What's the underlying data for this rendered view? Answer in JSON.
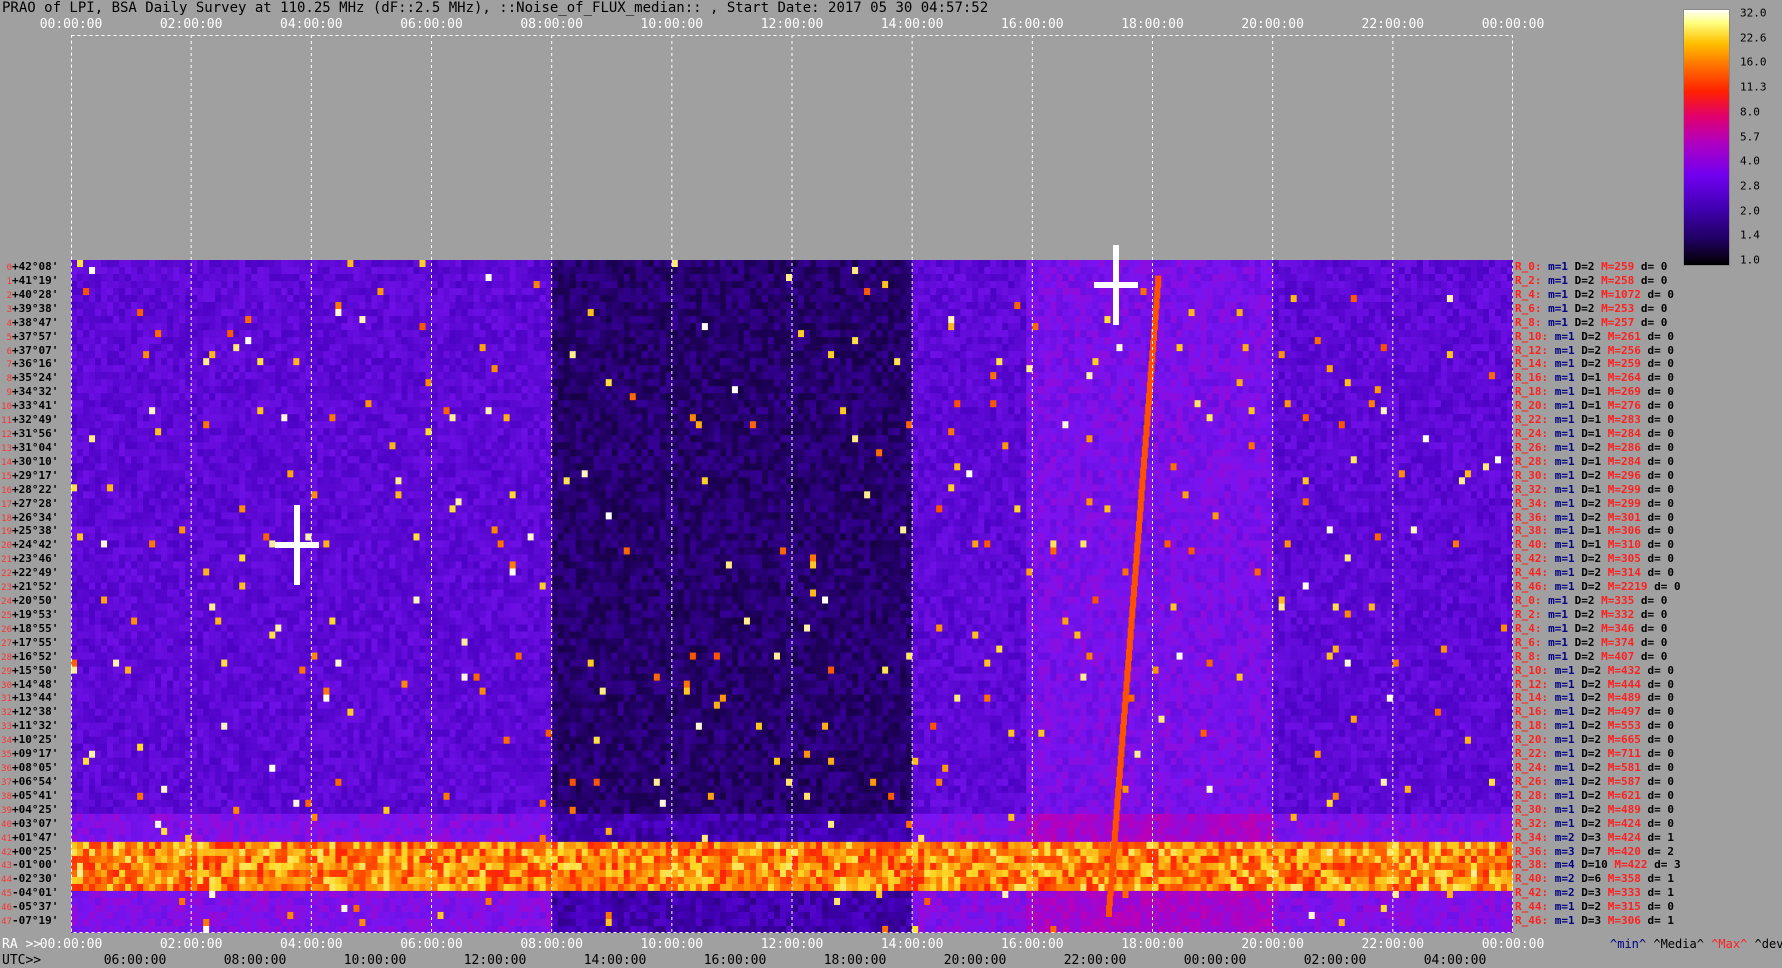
{
  "title": "PRAO of LPI, BSA Daily Survey at 110.25 MHz (dF::2.5 MHz), ::Noise_of_FLUX_median:: , Start Date: 2017 05 30 04:57:52",
  "top_ticks": [
    "00:00:00",
    "02:00:00",
    "04:00:00",
    "06:00:00",
    "08:00:00",
    "10:00:00",
    "12:00:00",
    "14:00:00",
    "16:00:00",
    "18:00:00",
    "20:00:00",
    "22:00:00",
    "00:00:00"
  ],
  "bottom_ra_prefix": "RA >>",
  "bottom_ra_ticks": [
    "00:00:00",
    "02:00:00",
    "04:00:00",
    "06:00:00",
    "08:00:00",
    "10:00:00",
    "12:00:00",
    "14:00:00",
    "16:00:00",
    "18:00:00",
    "20:00:00",
    "22:00:00",
    "00:00:00"
  ],
  "bottom_utc_prefix": "UTC>>",
  "bottom_utc_ticks": [
    "06:00:00",
    "08:00:00",
    "10:00:00",
    "12:00:00",
    "14:00:00",
    "16:00:00",
    "18:00:00",
    "20:00:00",
    "22:00:00",
    "00:00:00",
    "02:00:00",
    "04:00:00"
  ],
  "declinations": [
    {
      "i": "0",
      "d": "+42°08'"
    },
    {
      "i": "1",
      "d": "+41°19'"
    },
    {
      "i": "2",
      "d": "+40°28'"
    },
    {
      "i": "3",
      "d": "+39°38'"
    },
    {
      "i": "4",
      "d": "+38°47'"
    },
    {
      "i": "5",
      "d": "+37°57'"
    },
    {
      "i": "6",
      "d": "+37°07'"
    },
    {
      "i": "7",
      "d": "+36°16'"
    },
    {
      "i": "8",
      "d": "+35°24'"
    },
    {
      "i": "9",
      "d": "+34°32'"
    },
    {
      "i": "10",
      "d": "+33°41'"
    },
    {
      "i": "11",
      "d": "+32°49'"
    },
    {
      "i": "12",
      "d": "+31°56'"
    },
    {
      "i": "13",
      "d": "+31°04'"
    },
    {
      "i": "14",
      "d": "+30°10'"
    },
    {
      "i": "15",
      "d": "+29°17'"
    },
    {
      "i": "16",
      "d": "+28°22'"
    },
    {
      "i": "17",
      "d": "+27°28'"
    },
    {
      "i": "18",
      "d": "+26°34'"
    },
    {
      "i": "19",
      "d": "+25°38'"
    },
    {
      "i": "20",
      "d": "+24°42'"
    },
    {
      "i": "21",
      "d": "+23°46'"
    },
    {
      "i": "22",
      "d": "+22°49'"
    },
    {
      "i": "23",
      "d": "+21°52'"
    },
    {
      "i": "24",
      "d": "+20°50'"
    },
    {
      "i": "25",
      "d": "+19°53'"
    },
    {
      "i": "26",
      "d": "+18°55'"
    },
    {
      "i": "27",
      "d": "+17°55'"
    },
    {
      "i": "28",
      "d": "+16°52'"
    },
    {
      "i": "29",
      "d": "+15°50'"
    },
    {
      "i": "30",
      "d": "+14°48'"
    },
    {
      "i": "31",
      "d": "+13°44'"
    },
    {
      "i": "32",
      "d": "+12°38'"
    },
    {
      "i": "33",
      "d": "+11°32'"
    },
    {
      "i": "34",
      "d": "+10°25'"
    },
    {
      "i": "35",
      "d": "+09°17'"
    },
    {
      "i": "36",
      "d": "+08°05'"
    },
    {
      "i": "37",
      "d": "+06°54'"
    },
    {
      "i": "38",
      "d": "+05°41'"
    },
    {
      "i": "39",
      "d": "+04°25'"
    },
    {
      "i": "40",
      "d": "+03°07'"
    },
    {
      "i": "41",
      "d": "+01°47'"
    },
    {
      "i": "42",
      "d": "+00°25'"
    },
    {
      "i": "43",
      "d": "-01°00'"
    },
    {
      "i": "44",
      "d": "-02°30'"
    },
    {
      "i": "45",
      "d": "-04°01'"
    },
    {
      "i": "46",
      "d": "-05°37'"
    },
    {
      "i": "47",
      "d": "-07°19'"
    }
  ],
  "stats": [
    {
      "r": "R_0:",
      "m": "m=1",
      "d": "D=2",
      "M": "M=259",
      "dv": "d= 0"
    },
    {
      "r": "R_2:",
      "m": "m=1",
      "d": "D=2",
      "M": "M=258",
      "dv": "d= 0"
    },
    {
      "r": "R_4:",
      "m": "m=1",
      "d": "D=2",
      "M": "M=1072",
      "dv": "d= 0"
    },
    {
      "r": "R_6:",
      "m": "m=1",
      "d": "D=2",
      "M": "M=253",
      "dv": "d= 0"
    },
    {
      "r": "R_8:",
      "m": "m=1",
      "d": "D=2",
      "M": "M=257",
      "dv": "d= 0"
    },
    {
      "r": "R_10:",
      "m": "m=1",
      "d": "D=2",
      "M": "M=261",
      "dv": "d= 0"
    },
    {
      "r": "R_12:",
      "m": "m=1",
      "d": "D=2",
      "M": "M=256",
      "dv": "d= 0"
    },
    {
      "r": "R_14:",
      "m": "m=1",
      "d": "D=2",
      "M": "M=259",
      "dv": "d= 0"
    },
    {
      "r": "R_16:",
      "m": "m=1",
      "d": "D=1",
      "M": "M=264",
      "dv": "d= 0"
    },
    {
      "r": "R_18:",
      "m": "m=1",
      "d": "D=1",
      "M": "M=269",
      "dv": "d= 0"
    },
    {
      "r": "R_20:",
      "m": "m=1",
      "d": "D=1",
      "M": "M=276",
      "dv": "d= 0"
    },
    {
      "r": "R_22:",
      "m": "m=1",
      "d": "D=1",
      "M": "M=283",
      "dv": "d= 0"
    },
    {
      "r": "R_24:",
      "m": "m=1",
      "d": "D=1",
      "M": "M=284",
      "dv": "d= 0"
    },
    {
      "r": "R_26:",
      "m": "m=1",
      "d": "D=2",
      "M": "M=286",
      "dv": "d= 0"
    },
    {
      "r": "R_28:",
      "m": "m=1",
      "d": "D=1",
      "M": "M=284",
      "dv": "d= 0"
    },
    {
      "r": "R_30:",
      "m": "m=1",
      "d": "D=2",
      "M": "M=296",
      "dv": "d= 0"
    },
    {
      "r": "R_32:",
      "m": "m=1",
      "d": "D=1",
      "M": "M=299",
      "dv": "d= 0"
    },
    {
      "r": "R_34:",
      "m": "m=1",
      "d": "D=2",
      "M": "M=299",
      "dv": "d= 0"
    },
    {
      "r": "R_36:",
      "m": "m=1",
      "d": "D=2",
      "M": "M=301",
      "dv": "d= 0"
    },
    {
      "r": "R_38:",
      "m": "m=1",
      "d": "D=1",
      "M": "M=306",
      "dv": "d= 0"
    },
    {
      "r": "R_40:",
      "m": "m=1",
      "d": "D=1",
      "M": "M=310",
      "dv": "d= 0"
    },
    {
      "r": "R_42:",
      "m": "m=1",
      "d": "D=2",
      "M": "M=305",
      "dv": "d= 0"
    },
    {
      "r": "R_44:",
      "m": "m=1",
      "d": "D=2",
      "M": "M=314",
      "dv": "d= 0"
    },
    {
      "r": "R_46:",
      "m": "m=1",
      "d": "D=2",
      "M": "M=2219",
      "dv": "d= 0"
    },
    {
      "r": "R_0:",
      "m": "m=1",
      "d": "D=2",
      "M": "M=335",
      "dv": "d= 0"
    },
    {
      "r": "R_2:",
      "m": "m=1",
      "d": "D=2",
      "M": "M=332",
      "dv": "d= 0"
    },
    {
      "r": "R_4:",
      "m": "m=1",
      "d": "D=2",
      "M": "M=346",
      "dv": "d= 0"
    },
    {
      "r": "R_6:",
      "m": "m=1",
      "d": "D=2",
      "M": "M=374",
      "dv": "d= 0"
    },
    {
      "r": "R_8:",
      "m": "m=1",
      "d": "D=2",
      "M": "M=407",
      "dv": "d= 0"
    },
    {
      "r": "R_10:",
      "m": "m=1",
      "d": "D=2",
      "M": "M=432",
      "dv": "d= 0"
    },
    {
      "r": "R_12:",
      "m": "m=1",
      "d": "D=2",
      "M": "M=444",
      "dv": "d= 0"
    },
    {
      "r": "R_14:",
      "m": "m=1",
      "d": "D=2",
      "M": "M=489",
      "dv": "d= 0"
    },
    {
      "r": "R_16:",
      "m": "m=1",
      "d": "D=2",
      "M": "M=497",
      "dv": "d= 0"
    },
    {
      "r": "R_18:",
      "m": "m=1",
      "d": "D=2",
      "M": "M=553",
      "dv": "d= 0"
    },
    {
      "r": "R_20:",
      "m": "m=1",
      "d": "D=2",
      "M": "M=665",
      "dv": "d= 0"
    },
    {
      "r": "R_22:",
      "m": "m=1",
      "d": "D=2",
      "M": "M=711",
      "dv": "d= 0"
    },
    {
      "r": "R_24:",
      "m": "m=1",
      "d": "D=2",
      "M": "M=581",
      "dv": "d= 0"
    },
    {
      "r": "R_26:",
      "m": "m=1",
      "d": "D=2",
      "M": "M=587",
      "dv": "d= 0"
    },
    {
      "r": "R_28:",
      "m": "m=1",
      "d": "D=2",
      "M": "M=621",
      "dv": "d= 0"
    },
    {
      "r": "R_30:",
      "m": "m=1",
      "d": "D=2",
      "M": "M=489",
      "dv": "d= 0"
    },
    {
      "r": "R_32:",
      "m": "m=1",
      "d": "D=2",
      "M": "M=424",
      "dv": "d= 0"
    },
    {
      "r": "R_34:",
      "m": "m=2",
      "d": "D=3",
      "M": "M=424",
      "dv": "d= 1"
    },
    {
      "r": "R_36:",
      "m": "m=3",
      "d": "D=7",
      "M": "M=420",
      "dv": "d= 2"
    },
    {
      "r": "R_38:",
      "m": "m=4",
      "d": "D=10",
      "M": "M=422",
      "dv": "d= 3"
    },
    {
      "r": "R_40:",
      "m": "m=2",
      "d": "D=6",
      "M": "M=358",
      "dv": "d= 1"
    },
    {
      "r": "R_42:",
      "m": "m=2",
      "d": "D=3",
      "M": "M=333",
      "dv": "d= 1"
    },
    {
      "r": "R_44:",
      "m": "m=1",
      "d": "D=2",
      "M": "M=315",
      "dv": "d= 0"
    },
    {
      "r": "R_46:",
      "m": "m=1",
      "d": "D=3",
      "M": "M=306",
      "dv": "d= 1"
    }
  ],
  "legend": {
    "min": "^min^",
    "median": "^Media^",
    "max": "^Max^",
    "dev": "^devia^"
  },
  "colorbar": {
    "labels": [
      "32.0",
      "22.6",
      "16.0",
      "11.3",
      "8.0",
      "5.7",
      "4.0",
      "2.8",
      "2.0",
      "1.4",
      "1.0"
    ]
  },
  "colors": {
    "background": "#a0a0a0",
    "accent_red": "#ff2020",
    "dark_blue": "#000080"
  }
}
